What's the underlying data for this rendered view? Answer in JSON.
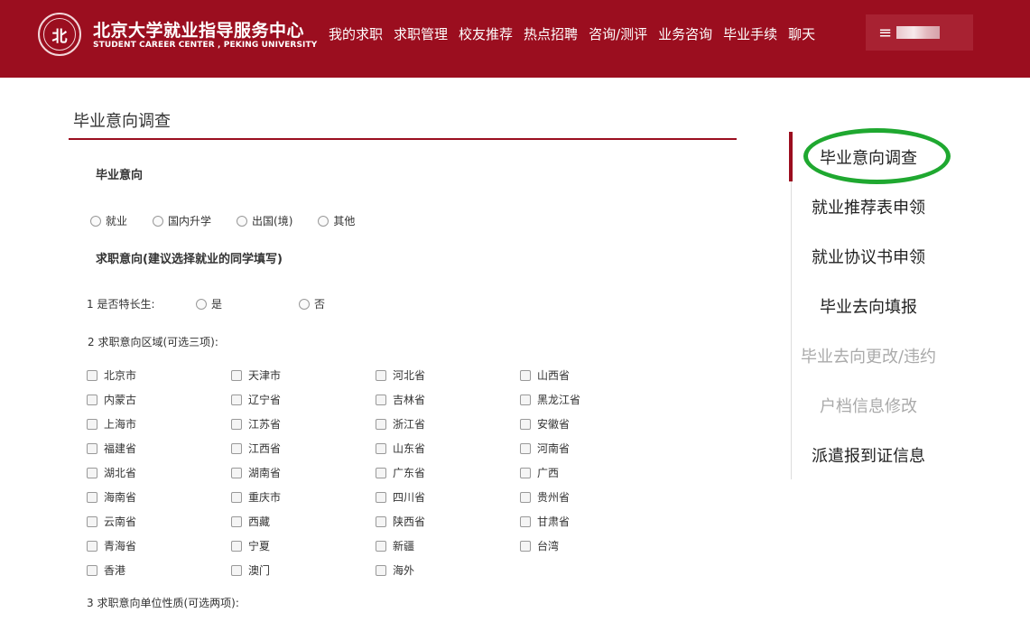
{
  "header": {
    "logo_text": "北",
    "title": "北京大学就业指导服务中心",
    "subtitle": "STUDENT CAREER CENTER , PEKING UNIVERSITY",
    "nav": [
      "我的求职",
      "求职管理",
      "校友推荐",
      "热点招聘",
      "咨询/测评",
      "业务咨询",
      "毕业手续",
      "聊天"
    ],
    "user_menu_icon": "≡"
  },
  "main": {
    "page_title": "毕业意向调查",
    "graduation_intent": {
      "heading": "毕业意向",
      "options": [
        "就业",
        "国内升学",
        "出国(境)",
        "其他"
      ]
    },
    "job_intent": {
      "heading": "求职意向(建议选择就业的同学填写)",
      "q1": {
        "label": "1 是否特长生:",
        "options": [
          "是",
          "否"
        ]
      },
      "q2": {
        "label": "2 求职意向区域(可选三项):"
      },
      "regions": [
        "北京市",
        "天津市",
        "河北省",
        "山西省",
        "内蒙古",
        "辽宁省",
        "吉林省",
        "黑龙江省",
        "上海市",
        "江苏省",
        "浙江省",
        "安徽省",
        "福建省",
        "江西省",
        "山东省",
        "河南省",
        "湖北省",
        "湖南省",
        "广东省",
        "广西",
        "海南省",
        "重庆市",
        "四川省",
        "贵州省",
        "云南省",
        "西藏",
        "陕西省",
        "甘肃省",
        "青海省",
        "宁夏",
        "新疆",
        "台湾",
        "香港",
        "澳门",
        "海外"
      ],
      "q3": {
        "label": "3 求职意向单位性质(可选两项):"
      }
    }
  },
  "sidebar": {
    "items": [
      {
        "label": "毕业意向调查",
        "state": "active"
      },
      {
        "label": "就业推荐表申领",
        "state": "enabled"
      },
      {
        "label": "就业协议书申领",
        "state": "enabled"
      },
      {
        "label": "毕业去向填报",
        "state": "enabled"
      },
      {
        "label": "毕业去向更改/违约",
        "state": "disabled"
      },
      {
        "label": "户档信息修改",
        "state": "disabled"
      },
      {
        "label": "派遣报到证信息",
        "state": "enabled"
      }
    ]
  },
  "colors": {
    "brand": "#9b0e1f",
    "highlight_ring": "#1fa830",
    "disabled_text": "#aaaaaa"
  }
}
